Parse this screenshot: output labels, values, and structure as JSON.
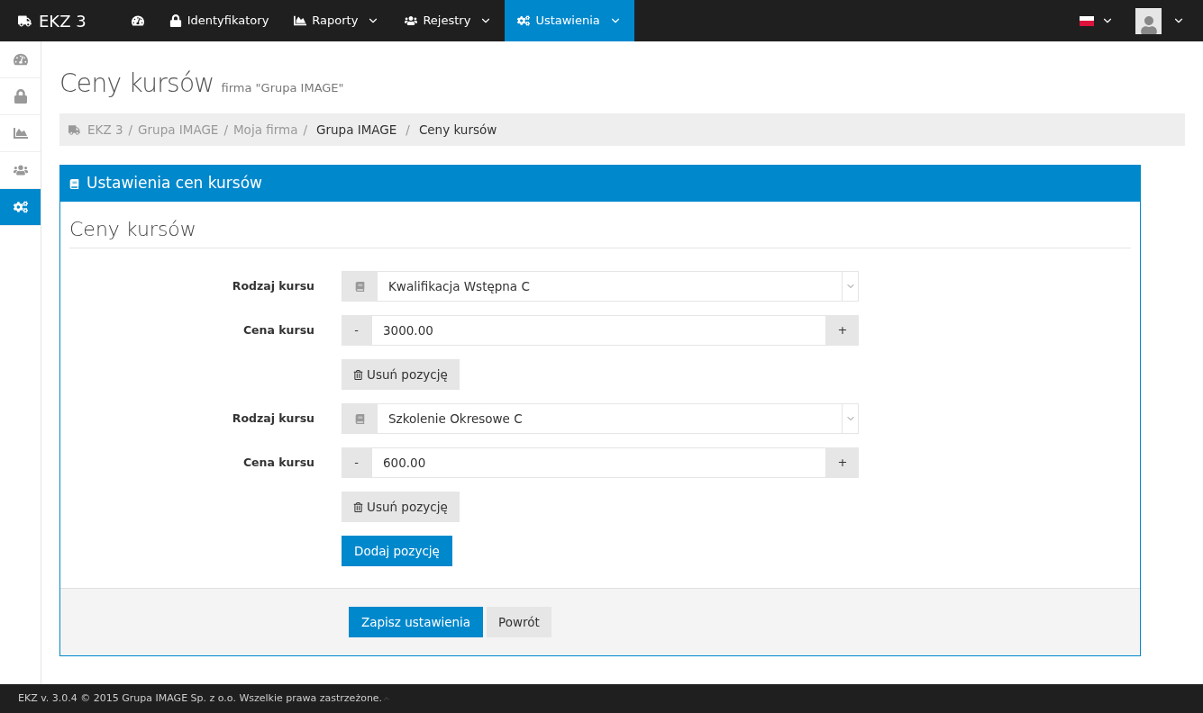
{
  "navbar": {
    "brand": "EKZ 3",
    "items": [
      {
        "dropdown": false,
        "selected": false
      },
      {
        "label": "Identyfikatory",
        "dropdown": false,
        "selected": false
      },
      {
        "label": "Raporty",
        "dropdown": true,
        "selected": false
      },
      {
        "label": "Rejestry",
        "dropdown": true,
        "selected": false
      },
      {
        "label": "Ustawienia",
        "dropdown": true,
        "selected": true
      }
    ]
  },
  "sidebar": {
    "items": [
      {
        "selected": false
      },
      {
        "selected": false
      },
      {
        "selected": false
      },
      {
        "selected": false
      },
      {
        "selected": true
      }
    ]
  },
  "page": {
    "title": "Ceny kursów",
    "subtitle": "firma \"Grupa IMAGE\""
  },
  "breadcrumb": [
    {
      "label": "EKZ 3",
      "link": true
    },
    {
      "separator": "/",
      "label": "Grupa IMAGE",
      "link": true
    },
    {
      "separator": "/",
      "label": "Moja firma",
      "link": true
    },
    {
      "separator": "/",
      "label": "Grupa IMAGE",
      "link": false
    },
    {
      "separator": "/",
      "label": "Ceny kursów",
      "link": false
    }
  ],
  "panel": {
    "title": "Ustawienia cen kursów",
    "section": "Ceny kursów",
    "courses": [
      {
        "type_label": "Rodzaj kursu",
        "type": "Kwalifikacja Wstępna C",
        "price_label": "Cena kursu",
        "price": "3000.00",
        "minus": "-",
        "plus": "+",
        "remove": "Usuń pozycję"
      },
      {
        "type_label": "Rodzaj kursu",
        "type": "Szkolenie Okresowe C",
        "price_label": "Cena kursu",
        "price": "600.00",
        "minus": "-",
        "plus": "+",
        "remove": "Usuń pozycję"
      }
    ],
    "add": "Dodaj pozycję",
    "save": "Zapisz ustawienia",
    "back": "Powrót"
  },
  "footer": "EKZ v. 3.0.4 © 2015 Grupa IMAGE Sp. z o.o. Wszelkie prawa zastrzeżone."
}
